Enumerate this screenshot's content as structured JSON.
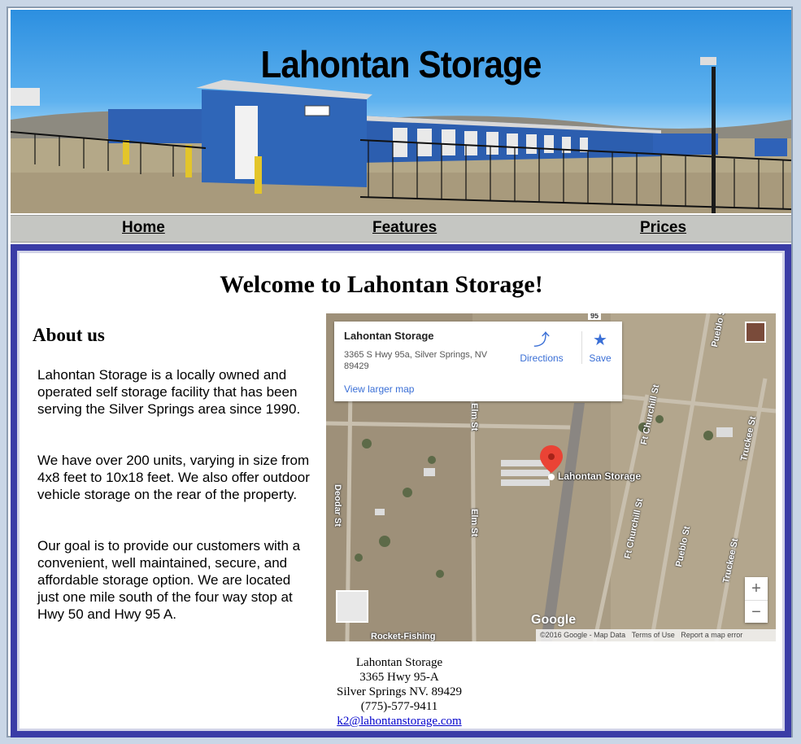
{
  "site": {
    "title": "Lahontan Storage"
  },
  "nav": {
    "items": [
      {
        "label": "Home"
      },
      {
        "label": "Features"
      },
      {
        "label": "Prices"
      }
    ]
  },
  "main": {
    "welcome": "Welcome to Lahontan Storage!",
    "about_heading": "About us",
    "about_paragraphs": [
      "Lahontan Storage is a locally owned and operated self storage facility that has been serving the Silver Springs area since 1990.",
      "We have over 200 units, varying in size from 4x8 feet to 10x18 feet. We also offer outdoor vehicle storage on the rear of the property.",
      "Our goal is to provide our customers with a convenient, well maintained, secure, and affordable storage option. We are located just one mile south of the four way stop at Hwy 50 and Hwy 95 A."
    ]
  },
  "map": {
    "card_title": "Lahontan Storage",
    "card_address": "3365 S Hwy 95a, Silver Springs, NV 89429",
    "view_larger": "View larger map",
    "directions": "Directions",
    "save": "Save",
    "pin_label": "Lahontan Storage",
    "streets": [
      "Deodar St",
      "Elm St",
      "Ft Churchill St",
      "Pueblo St",
      "Truckee St",
      "Rocket-Fishing",
      "95"
    ],
    "footer": {
      "copyright": "©2016 Google - Map Data",
      "terms": "Terms of Use",
      "report": "Report a map error"
    },
    "logo": "Google",
    "zoom_in": "+",
    "zoom_out": "−"
  },
  "contact": {
    "name": "Lahontan Storage",
    "street": "3365 Hwy 95-A",
    "city": "Silver Springs NV. 89429",
    "phone": "(775)-577-9411",
    "email": "k2@lahontanstorage.com"
  }
}
